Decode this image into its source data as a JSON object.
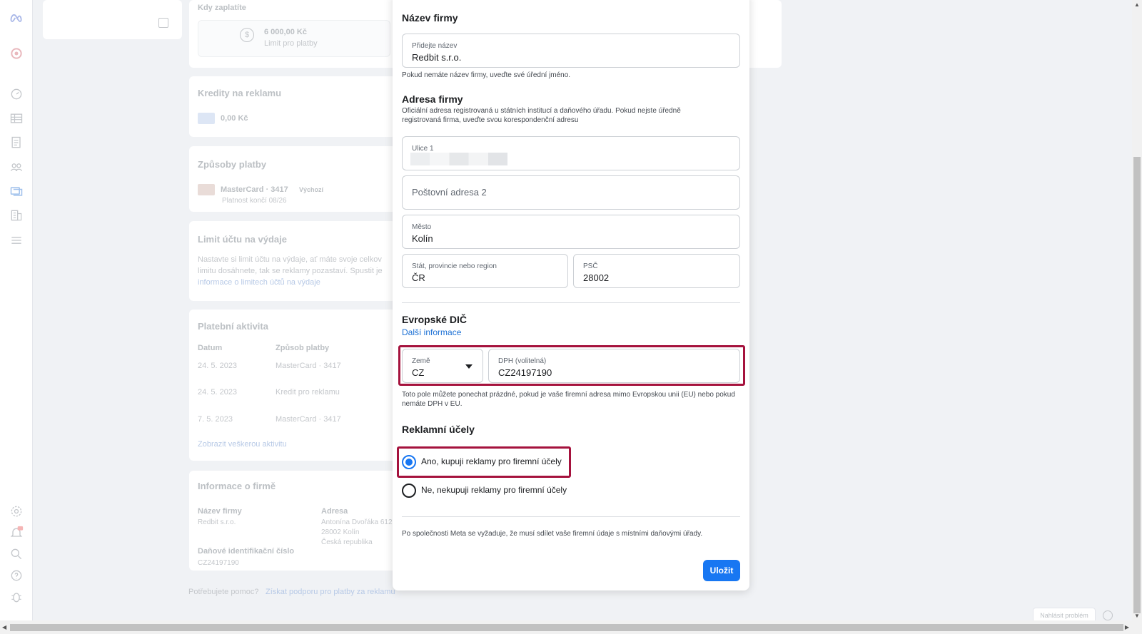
{
  "background": {
    "kdy_zaplatite": "Kdy zaplatíte",
    "amount": "6 000,00 Kč",
    "amount_sub": "Limit pro platby",
    "credits_title": "Kredity na reklamu",
    "credits_value": "0,00 Kč",
    "payment_methods_title": "Způsoby platby",
    "card_name": "MasterCard · 3417",
    "card_default": "Výchozí",
    "card_expiry": "Platnost končí 08/26",
    "limit_title": "Limit účtu na výdaje",
    "limit_line1": "Nastavte si limit účtu na výdaje, ať máte svoje celkov",
    "limit_line2": "limitu dosáhnete, tak se reklamy pozastaví. Spustit je",
    "limit_link": "informace o limitech účtů na výdaje",
    "activity_title": "Platební aktivita",
    "col_date": "Datum",
    "col_method": "Způsob platby",
    "rows": [
      {
        "date": "24. 5. 2023",
        "method": "MasterCard · 3417"
      },
      {
        "date": "24. 5. 2023",
        "method": "Kredit pro reklamu"
      },
      {
        "date": "7. 5. 2023",
        "method": "MasterCard · 3417"
      }
    ],
    "all_activity": "Zobrazit veškerou aktivitu",
    "company_info_title": "Informace o firmě",
    "company_name_label": "Název firmy",
    "company_name_value": "Redbit s.r.o.",
    "address_label": "Adresa",
    "address_line1": "Antonína Dvořáka 612",
    "address_line2": "28002 Kolín",
    "address_line3": "Česká republika",
    "tax_label": "Daňové identifikační číslo",
    "tax_value": "CZ24197190",
    "help_prefix": "Potřebujete pomoc?",
    "help_link": "Získat podporu pro platby za reklamu",
    "report_problem": "Nahlásit problém"
  },
  "modal": {
    "company_name_heading": "Název firmy",
    "company_name_field": {
      "label": "Přidejte název",
      "value": "Redbit s.r.o."
    },
    "company_name_help": "Pokud nemáte název firmy, uveďte své úřední jméno.",
    "address_heading": "Adresa firmy",
    "address_help": "Oficiální adresa registrovaná u státních institucí a daňového úřadu. Pokud nejste úředně registrovaná firma, uveďte svou korespondenční adresu",
    "street1": {
      "label": "Ulice 1",
      "value": ""
    },
    "street2_placeholder": "Poštovní adresa 2",
    "city": {
      "label": "Město",
      "value": "Kolín"
    },
    "state": {
      "label": "Stát, provincie nebo region",
      "value": "ČR"
    },
    "zip": {
      "label": "PSČ",
      "value": "28002"
    },
    "vat_heading": "Evropské DIČ",
    "more_info": "Další informace",
    "country": {
      "label": "Země",
      "value": "CZ"
    },
    "vat": {
      "label": "DPH (volitelná)",
      "value": "CZ24197190"
    },
    "vat_help": "Toto pole můžete ponechat prázdné, pokud je vaše firemní adresa mimo Evropskou unii (EU) nebo pokud nemáte DPH v EU.",
    "ad_purpose_heading": "Reklamní účely",
    "option_yes": "Ano, kupuji reklamy pro firemní účely",
    "option_no": "Ne, nekupuji reklamy pro firemní účely",
    "footer_note": "Po společnosti Meta se vyžaduje, že musí sdílet vaše firemní údaje s místními daňovými úřady.",
    "save_label": "Uložit"
  },
  "colors": {
    "accent": "#1877f2",
    "highlight": "#a5123d"
  }
}
